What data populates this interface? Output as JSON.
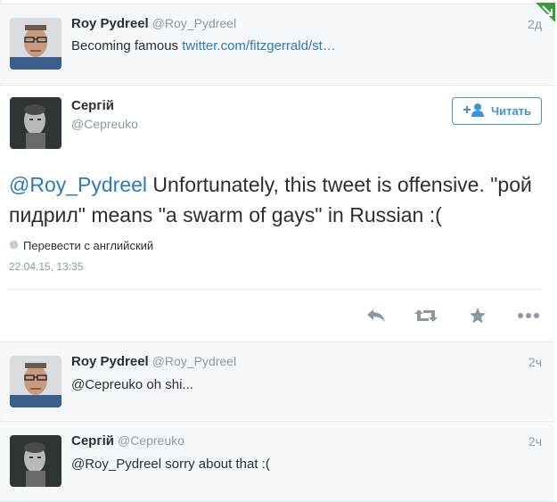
{
  "tweets_top": {
    "name": "Roy Pydreel",
    "handle": "@Roy_Pydreel",
    "time": "2д",
    "text_prefix": "Becoming famous ",
    "link": "twitter.com/fitzgerrald/st…"
  },
  "main_tweet": {
    "name": "Сергій",
    "handle": "@Cepreuko",
    "follow_label": "Читать",
    "mention": "@Roy_Pydreel",
    "text": " Unfortunately, this tweet is offensive. \"рой пидрил\" means \"a swarm of gays\" in Russian :(",
    "translate_label": "Перевести с английский",
    "date": "22.04.15, 13:35",
    "actions": [
      "reply-icon",
      "retweet-icon",
      "favorite-icon",
      "more-icon"
    ]
  },
  "replies": [
    {
      "name": "Roy Pydreel",
      "handle": "@Roy_Pydreel",
      "time": "2ч",
      "text": "@Cepreuko oh shi..."
    },
    {
      "name": "Сергій",
      "handle": "@Cepreuko",
      "time": "2ч",
      "text": "@Roy_Pydreel sorry about that :("
    }
  ],
  "colors": {
    "link": "#2b7bb9",
    "muted": "#8899a6",
    "button": "#3b94d9",
    "background_alt": "#f5f8fa",
    "corner": "#3a9a3a"
  }
}
